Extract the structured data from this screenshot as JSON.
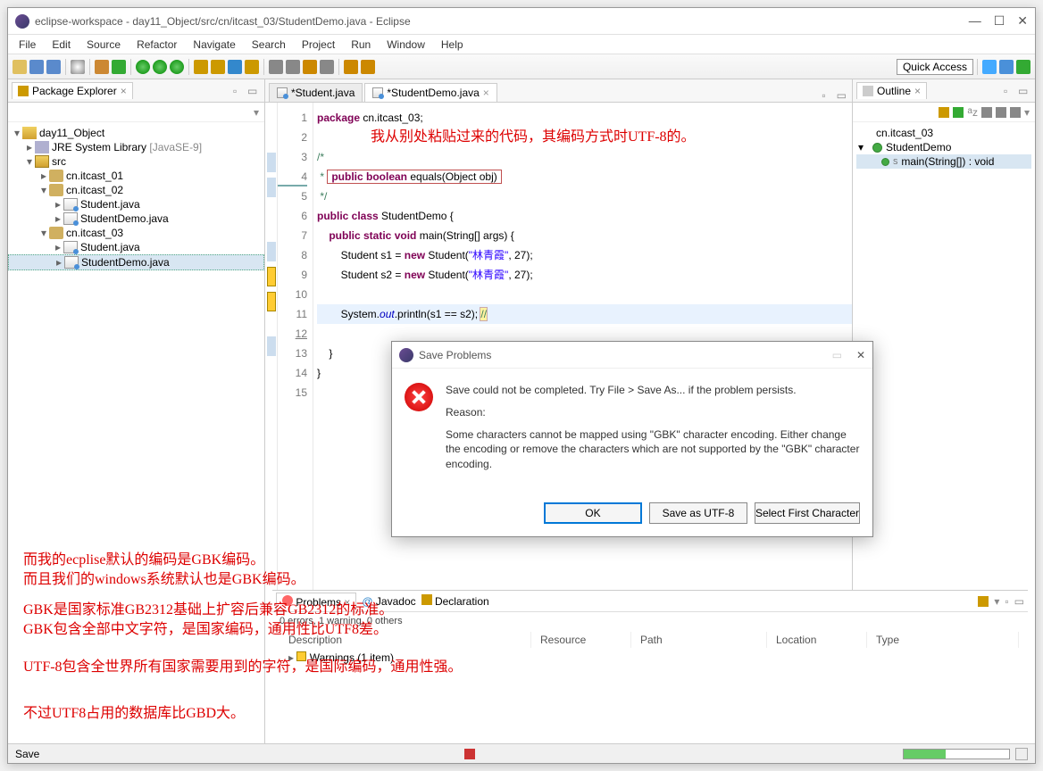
{
  "window": {
    "title": "eclipse-workspace - day11_Object/src/cn/itcast_03/StudentDemo.java - Eclipse"
  },
  "menu": [
    "File",
    "Edit",
    "Source",
    "Refactor",
    "Navigate",
    "Search",
    "Project",
    "Run",
    "Window",
    "Help"
  ],
  "quickAccess": "Quick Access",
  "packageExplorer": {
    "title": "Package Explorer",
    "project": "day11_Object",
    "jre": "JRE System Library",
    "jreQual": "[JavaSE-9]",
    "src": "src",
    "packages": [
      {
        "name": "cn.itcast_01",
        "expanded": false
      },
      {
        "name": "cn.itcast_02",
        "expanded": true,
        "files": [
          "Student.java",
          "StudentDemo.java"
        ]
      },
      {
        "name": "cn.itcast_03",
        "expanded": true,
        "files": [
          "Student.java",
          "StudentDemo.java"
        ],
        "selected": "StudentDemo.java"
      }
    ]
  },
  "editor": {
    "tabs": [
      {
        "label": "*Student.java",
        "active": false
      },
      {
        "label": "*StudentDemo.java",
        "active": true
      }
    ],
    "annotation1": "我从别处粘贴过来的代码，其编码方式时UTF-8的。",
    "lines": {
      "l1": {
        "kw": "package",
        "rest": " cn.itcast_03;"
      },
      "l3": "/*",
      "l4": {
        "star": " * ",
        "kw": "public boolean",
        "rest": " equals(Object obj)"
      },
      "l5": " */",
      "l6": {
        "kw1": "public class",
        "name": " StudentDemo {",
        "rest": ""
      },
      "l7": {
        "indent": "    ",
        "kw": "public static void",
        "name": " main(String[] args) {"
      },
      "l8": {
        "indent": "        Student s1 = ",
        "kw": "new",
        "ctor": " Student(",
        "str": "\"林青霞\"",
        "rest": ", 27);"
      },
      "l9": {
        "indent": "        Student s2 = ",
        "kw": "new",
        "ctor": " Student(",
        "str": "\"林青霞\"",
        "rest": ", 27);"
      },
      "l11": {
        "indent": "        System.",
        "field": "out",
        "rest": ".println(s1 == s2); ",
        "com": "//"
      },
      "l13": "    }",
      "l14": "}"
    }
  },
  "outline": {
    "title": "Outline",
    "pkg": "cn.itcast_03",
    "class": "StudentDemo",
    "method": "main(String[]) : void"
  },
  "dialog": {
    "title": "Save Problems",
    "msg1": "Save could not be completed. Try File > Save As... if the problem persists.",
    "reasonLabel": "Reason:",
    "msg2": "Some characters cannot be mapped using \"GBK\" character encoding. Either change the encoding or remove the characters which are not supported by the \"GBK\" character encoding.",
    "btnOk": "OK",
    "btnSaveAs": "Save as UTF-8",
    "btnSelect": "Select First Character"
  },
  "problems": {
    "tabs": [
      "Problems",
      "Javadoc",
      "Declaration"
    ],
    "summary": "0 errors, 1 warning, 0 others",
    "cols": [
      "Description",
      "Resource",
      "Path",
      "Location",
      "Type"
    ],
    "warningRow": "Warnings (1 item)"
  },
  "annotations": {
    "a1": "而我的ecplise默认的编码是GBK编码。",
    "a2": "而且我们的windows系统默认也是GBK编码。",
    "a3": "GBK是国家标准GB2312基础上扩容后兼容GB2312的标准。",
    "a4": "GBK包含全部中文字符，是国家编码，通用性比UTF8差。",
    "a5": "UTF-8包含全世界所有国家需要用到的字符，是国际编码，通用性强。",
    "a6": "不过UTF8占用的数据库比GBD大。"
  },
  "status": {
    "text": "Save"
  }
}
